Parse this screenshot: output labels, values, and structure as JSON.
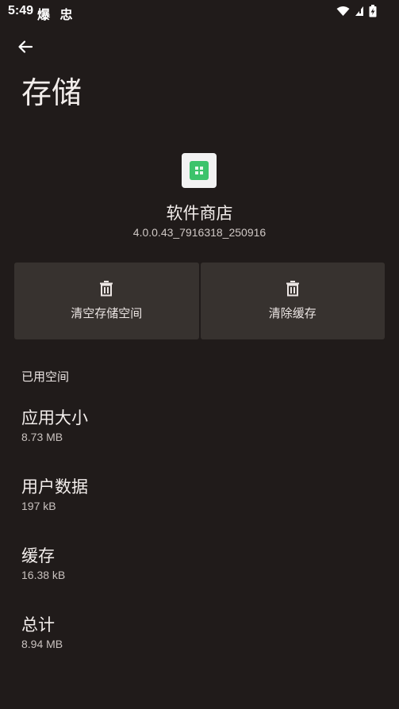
{
  "status_bar": {
    "time": "5:49",
    "notification_icons": "爆 忠"
  },
  "header": {
    "back_icon": "arrow-left-icon",
    "title": "存储"
  },
  "app": {
    "icon": "app-store-icon",
    "icon_color": "#3cc36b",
    "name": "软件商店",
    "version": "4.0.0.43_7916318_250916"
  },
  "actions": {
    "clear_storage": "清空存储空间",
    "clear_cache": "清除缓存"
  },
  "section": {
    "used_space": "已用空间"
  },
  "stats": [
    {
      "label": "应用大小",
      "value": "8.73 MB"
    },
    {
      "label": "用户数据",
      "value": "197 kB"
    },
    {
      "label": "缓存",
      "value": "16.38 kB"
    },
    {
      "label": "总计",
      "value": "8.94 MB"
    }
  ],
  "colors": {
    "background": "#201b1a",
    "button_bg": "#37322f",
    "text": "#ece6e4"
  }
}
